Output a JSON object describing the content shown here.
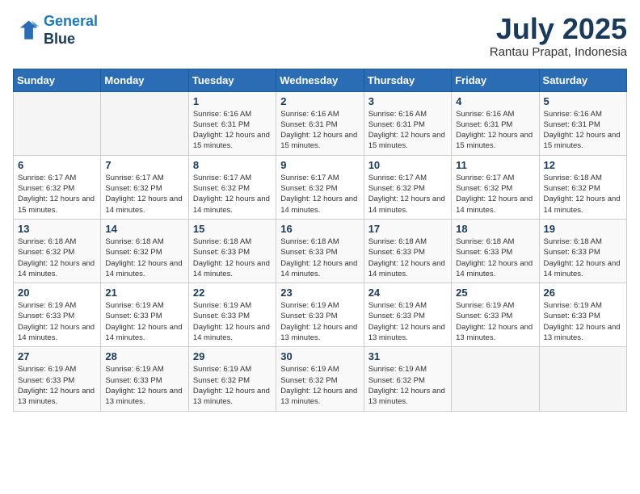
{
  "header": {
    "logo_line1": "General",
    "logo_line2": "Blue",
    "month": "July 2025",
    "location": "Rantau Prapat, Indonesia"
  },
  "days_of_week": [
    "Sunday",
    "Monday",
    "Tuesday",
    "Wednesday",
    "Thursday",
    "Friday",
    "Saturday"
  ],
  "weeks": [
    [
      {
        "day": "",
        "info": ""
      },
      {
        "day": "",
        "info": ""
      },
      {
        "day": "1",
        "info": "Sunrise: 6:16 AM\nSunset: 6:31 PM\nDaylight: 12 hours and 15 minutes."
      },
      {
        "day": "2",
        "info": "Sunrise: 6:16 AM\nSunset: 6:31 PM\nDaylight: 12 hours and 15 minutes."
      },
      {
        "day": "3",
        "info": "Sunrise: 6:16 AM\nSunset: 6:31 PM\nDaylight: 12 hours and 15 minutes."
      },
      {
        "day": "4",
        "info": "Sunrise: 6:16 AM\nSunset: 6:31 PM\nDaylight: 12 hours and 15 minutes."
      },
      {
        "day": "5",
        "info": "Sunrise: 6:16 AM\nSunset: 6:31 PM\nDaylight: 12 hours and 15 minutes."
      }
    ],
    [
      {
        "day": "6",
        "info": "Sunrise: 6:17 AM\nSunset: 6:32 PM\nDaylight: 12 hours and 15 minutes."
      },
      {
        "day": "7",
        "info": "Sunrise: 6:17 AM\nSunset: 6:32 PM\nDaylight: 12 hours and 14 minutes."
      },
      {
        "day": "8",
        "info": "Sunrise: 6:17 AM\nSunset: 6:32 PM\nDaylight: 12 hours and 14 minutes."
      },
      {
        "day": "9",
        "info": "Sunrise: 6:17 AM\nSunset: 6:32 PM\nDaylight: 12 hours and 14 minutes."
      },
      {
        "day": "10",
        "info": "Sunrise: 6:17 AM\nSunset: 6:32 PM\nDaylight: 12 hours and 14 minutes."
      },
      {
        "day": "11",
        "info": "Sunrise: 6:17 AM\nSunset: 6:32 PM\nDaylight: 12 hours and 14 minutes."
      },
      {
        "day": "12",
        "info": "Sunrise: 6:18 AM\nSunset: 6:32 PM\nDaylight: 12 hours and 14 minutes."
      }
    ],
    [
      {
        "day": "13",
        "info": "Sunrise: 6:18 AM\nSunset: 6:32 PM\nDaylight: 12 hours and 14 minutes."
      },
      {
        "day": "14",
        "info": "Sunrise: 6:18 AM\nSunset: 6:32 PM\nDaylight: 12 hours and 14 minutes."
      },
      {
        "day": "15",
        "info": "Sunrise: 6:18 AM\nSunset: 6:33 PM\nDaylight: 12 hours and 14 minutes."
      },
      {
        "day": "16",
        "info": "Sunrise: 6:18 AM\nSunset: 6:33 PM\nDaylight: 12 hours and 14 minutes."
      },
      {
        "day": "17",
        "info": "Sunrise: 6:18 AM\nSunset: 6:33 PM\nDaylight: 12 hours and 14 minutes."
      },
      {
        "day": "18",
        "info": "Sunrise: 6:18 AM\nSunset: 6:33 PM\nDaylight: 12 hours and 14 minutes."
      },
      {
        "day": "19",
        "info": "Sunrise: 6:18 AM\nSunset: 6:33 PM\nDaylight: 12 hours and 14 minutes."
      }
    ],
    [
      {
        "day": "20",
        "info": "Sunrise: 6:19 AM\nSunset: 6:33 PM\nDaylight: 12 hours and 14 minutes."
      },
      {
        "day": "21",
        "info": "Sunrise: 6:19 AM\nSunset: 6:33 PM\nDaylight: 12 hours and 14 minutes."
      },
      {
        "day": "22",
        "info": "Sunrise: 6:19 AM\nSunset: 6:33 PM\nDaylight: 12 hours and 14 minutes."
      },
      {
        "day": "23",
        "info": "Sunrise: 6:19 AM\nSunset: 6:33 PM\nDaylight: 12 hours and 13 minutes."
      },
      {
        "day": "24",
        "info": "Sunrise: 6:19 AM\nSunset: 6:33 PM\nDaylight: 12 hours and 13 minutes."
      },
      {
        "day": "25",
        "info": "Sunrise: 6:19 AM\nSunset: 6:33 PM\nDaylight: 12 hours and 13 minutes."
      },
      {
        "day": "26",
        "info": "Sunrise: 6:19 AM\nSunset: 6:33 PM\nDaylight: 12 hours and 13 minutes."
      }
    ],
    [
      {
        "day": "27",
        "info": "Sunrise: 6:19 AM\nSunset: 6:33 PM\nDaylight: 12 hours and 13 minutes."
      },
      {
        "day": "28",
        "info": "Sunrise: 6:19 AM\nSunset: 6:33 PM\nDaylight: 12 hours and 13 minutes."
      },
      {
        "day": "29",
        "info": "Sunrise: 6:19 AM\nSunset: 6:32 PM\nDaylight: 12 hours and 13 minutes."
      },
      {
        "day": "30",
        "info": "Sunrise: 6:19 AM\nSunset: 6:32 PM\nDaylight: 12 hours and 13 minutes."
      },
      {
        "day": "31",
        "info": "Sunrise: 6:19 AM\nSunset: 6:32 PM\nDaylight: 12 hours and 13 minutes."
      },
      {
        "day": "",
        "info": ""
      },
      {
        "day": "",
        "info": ""
      }
    ]
  ]
}
